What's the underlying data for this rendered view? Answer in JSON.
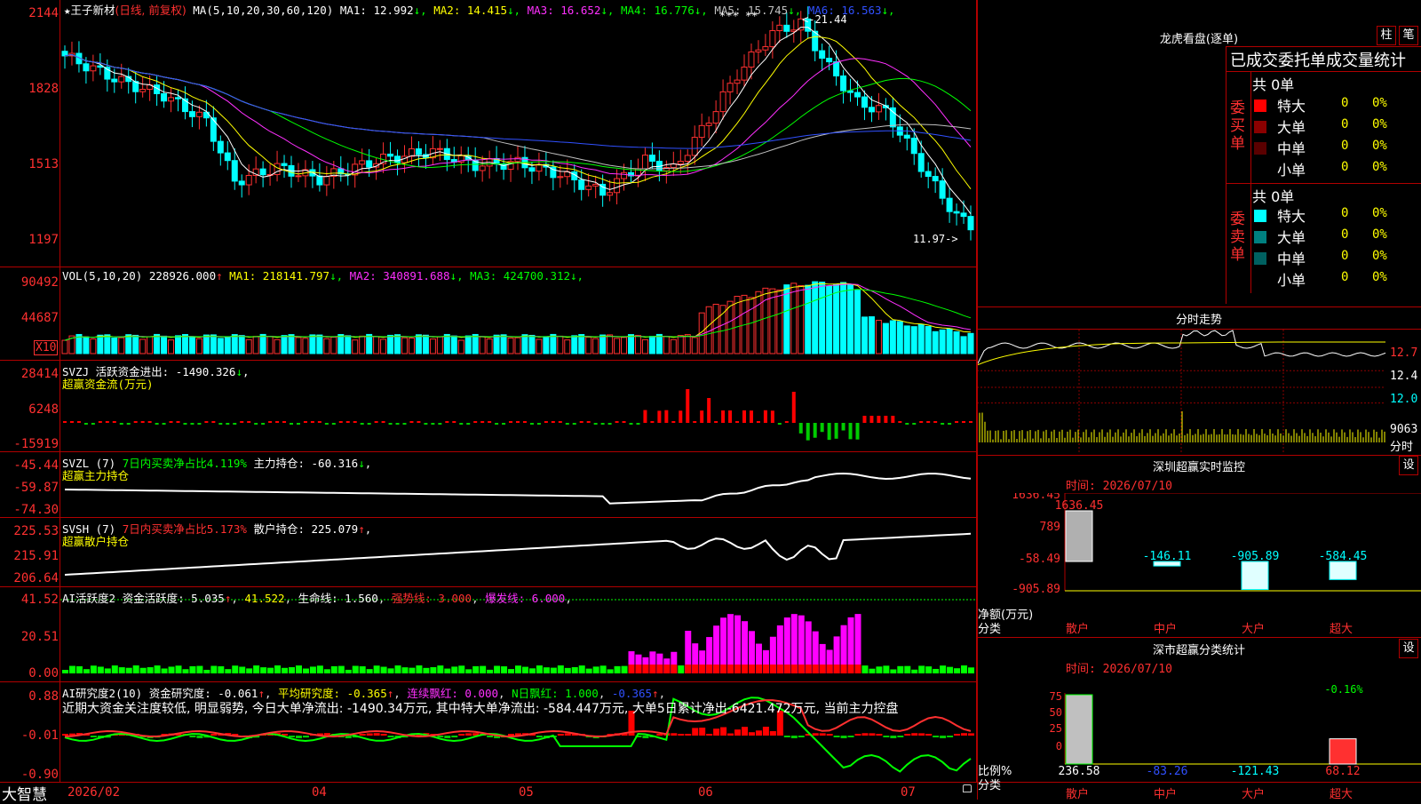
{
  "app": {
    "brand": "大智慧"
  },
  "main": {
    "star": "★",
    "stock": "王子新材",
    "mode": "(日线, 前复权)",
    "ma_prefix": "MA(5,10,20,30,60,120)",
    "ma": [
      {
        "name": "MA1",
        "value": "12.992",
        "color": "#ffffff"
      },
      {
        "name": "MA2",
        "value": "14.415",
        "color": "#ffff00"
      },
      {
        "name": "MA3",
        "value": "16.652",
        "color": "#ff30ff"
      },
      {
        "name": "MA4",
        "value": "16.776",
        "color": "#00ff00"
      },
      {
        "name": "MA5",
        "value": "15.745",
        "color": "#c0c0c0"
      },
      {
        "name": "MA6",
        "value": "16.563",
        "color": "#3050ff"
      }
    ],
    "y_labels": [
      "2144",
      "1828",
      "1513",
      "1197"
    ],
    "high_label": "21.44",
    "low_label": "11.97",
    "marks": "*** **"
  },
  "vol": {
    "legend": "VOL(5,10,20)",
    "value": "228926.000",
    "ma": [
      {
        "name": "MA1",
        "value": "218141.797",
        "color": "#ffff00"
      },
      {
        "name": "MA2",
        "value": "340891.688",
        "color": "#ff30ff"
      },
      {
        "name": "MA3",
        "value": "424700.312",
        "color": "#00ff00"
      }
    ],
    "y_labels": [
      "90492",
      "44687"
    ],
    "unit": "X10"
  },
  "svzj": {
    "name": "SVZJ",
    "label": "活跃资金进出:",
    "value": "-1490.326",
    "subtitle": "超赢资金流(万元)",
    "y_labels": [
      "28414",
      "6248",
      "-15919"
    ]
  },
  "svzl": {
    "name": "SVZL (7)",
    "desc": "7日内买卖净占比4.119%",
    "label": "主力持仓:",
    "value": "-60.316",
    "subtitle": "超赢主力持仓",
    "y_labels": [
      "-45.44",
      "-59.87",
      "-74.30"
    ]
  },
  "svsh": {
    "name": "SVSH (7)",
    "desc": "7日内买卖净占比5.173%",
    "label": "散户持仓:",
    "value": "225.079",
    "subtitle": "超赢散户持仓",
    "y_labels": [
      "225.53",
      "215.91",
      "206.64"
    ]
  },
  "ai_act": {
    "name": "AI活跃度2",
    "label": "资金活跃度:",
    "value": "5.035",
    "v2": "41.522",
    "life": "生命线: 1.560",
    "strong": "强势线: 3.000",
    "burst": "爆发线: 6.000",
    "y_labels": [
      "41.52",
      "20.51",
      "0.00"
    ]
  },
  "ai_res": {
    "name": "AI研究度2(10)",
    "label": "资金研究度:",
    "value": "-0.061",
    "avg": "平均研究度: -0.365",
    "cont": "连续飘红: 0.000",
    "n": "N日飘红: 1.000",
    "last": "-0.365",
    "text": "近期大资金关注度较低, 明显弱势, 今日大单净流出: -1490.34万元, 其中特大单净流出: -584.447万元, 大单5日累计净出-6421.472万元, 当前主力控盘",
    "y_labels": [
      "0.88",
      "-0.01",
      "-0.90"
    ]
  },
  "x_axis": [
    "2026/02",
    "04",
    "05",
    "06",
    "07"
  ],
  "right": {
    "dragon_title": "龙虎看盘(逐单)",
    "btn_col": "柱",
    "btn_bi": "笔",
    "order_header": "已成交委托单成交量统计",
    "buy": {
      "label": "委买单",
      "total": "共 0单",
      "rows": [
        {
          "name": "特大",
          "color": "#ff0000",
          "vol": "0",
          "pct": "0%"
        },
        {
          "name": "大单",
          "color": "#8b0000",
          "vol": "0",
          "pct": "0%"
        },
        {
          "name": "中单",
          "color": "#5a0000",
          "vol": "0",
          "pct": "0%"
        },
        {
          "name": "小单",
          "color": "#000000",
          "vol": "0",
          "pct": "0%"
        }
      ]
    },
    "sell": {
      "label": "委卖单",
      "total": "共 0单",
      "rows": [
        {
          "name": "特大",
          "color": "#00ffff",
          "vol": "0",
          "pct": "0%"
        },
        {
          "name": "大单",
          "color": "#008080",
          "vol": "0",
          "pct": "0%"
        },
        {
          "name": "中单",
          "color": "#006060",
          "vol": "0",
          "pct": "0%"
        },
        {
          "name": "小单",
          "color": "#000000",
          "vol": "0",
          "pct": "0%"
        }
      ]
    },
    "intraday": {
      "title": "分时走势",
      "y_labels": [
        "12.7",
        "12.4",
        "12.0"
      ],
      "vol_label": "9063",
      "bottom_label": "分时"
    },
    "monitor": {
      "title": "深圳超赢实时监控",
      "btn": "设",
      "time": "时间: 2026/07/10",
      "y_labels": [
        "1636.45",
        "789",
        "-58.49",
        "-905.89"
      ],
      "unit": "净额(万元)",
      "cat_label": "分类",
      "categories": [
        "散户",
        "中户",
        "大户",
        "超大"
      ],
      "values": [
        "1636.45",
        "-146.11",
        "-905.89",
        "-584.45"
      ]
    },
    "classify": {
      "title": "深市超赢分类统计",
      "btn": "设",
      "time": "时间: 2026/07/10",
      "y_labels": [
        "75",
        "50",
        "25",
        "0"
      ],
      "unit": "比例%",
      "cat_label": "分类",
      "categories": [
        "散户",
        "中户",
        "大户",
        "超大"
      ],
      "values": [
        "236.58",
        "-83.26",
        "-121.43",
        "68.12"
      ],
      "top_label": "-0.16%"
    }
  }
}
